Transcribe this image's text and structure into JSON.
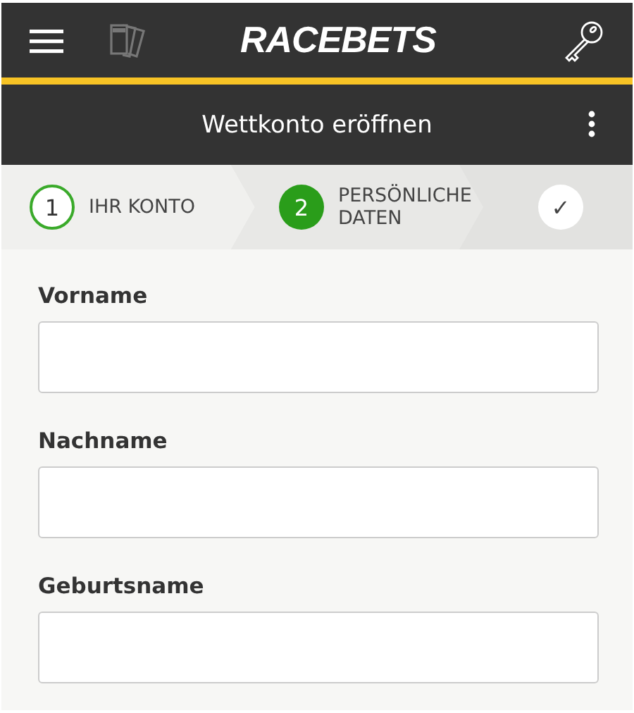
{
  "header": {
    "logo": "RACEBETS"
  },
  "title_bar": {
    "title": "Wettkonto eröffnen"
  },
  "steps": [
    {
      "number": "1",
      "label": "IHR KONTO",
      "completed": true,
      "selected": false
    },
    {
      "number": "2",
      "label": "PERSÖNLICHE DATEN",
      "completed": false,
      "selected": true
    },
    {
      "number": "✓",
      "completed": false,
      "selected": false
    }
  ],
  "fields": [
    {
      "label": "Vorname"
    },
    {
      "label": "Nachname"
    },
    {
      "label": "Geburtsname"
    }
  ]
}
